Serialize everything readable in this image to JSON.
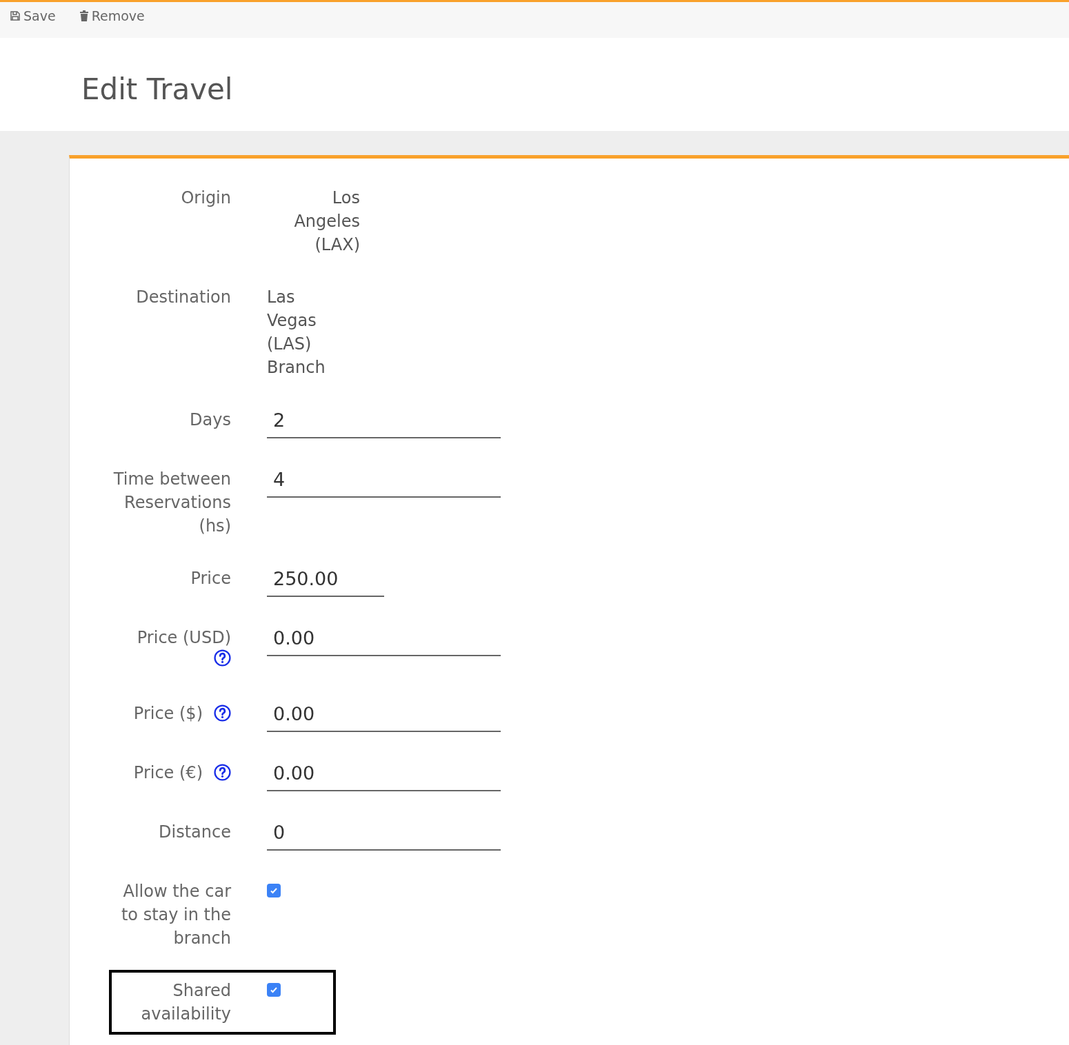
{
  "toolbar": [
    {
      "kind": "save",
      "label": "Save"
    },
    {
      "kind": "remove",
      "label": "Remove"
    }
  ],
  "title": "Edit Travel",
  "fields": [
    {
      "kind": "static",
      "label": "Origin",
      "value": "Los Angeles (LAX)",
      "right_aligned": true
    },
    {
      "kind": "static",
      "label": "Destination",
      "value": "Las Vegas (LAS) Branch",
      "right_aligned": false
    },
    {
      "kind": "input",
      "label": "Days",
      "value": "2",
      "narrow": false
    },
    {
      "kind": "input",
      "label": "Time between Reservations (hs)",
      "value": "4",
      "narrow": false
    },
    {
      "kind": "input",
      "label": "Price",
      "value": "250.00",
      "narrow": true
    },
    {
      "kind": "input",
      "label": "Price (USD)",
      "value": "0.00",
      "narrow": false,
      "help": true,
      "help_below": true
    },
    {
      "kind": "input",
      "label": "Price ($)",
      "value": "0.00",
      "narrow": false,
      "help": true,
      "help_below": false
    },
    {
      "kind": "input",
      "label": "Price (€)",
      "value": "0.00",
      "narrow": false,
      "help": true,
      "help_below": false
    },
    {
      "kind": "input",
      "label": "Distance",
      "value": "0",
      "narrow": false
    },
    {
      "kind": "checkbox",
      "label": "Allow the car to stay in the branch",
      "checked": true,
      "highlighted": false
    },
    {
      "kind": "checkbox",
      "label": "Shared availability",
      "checked": true,
      "highlighted": true
    }
  ]
}
